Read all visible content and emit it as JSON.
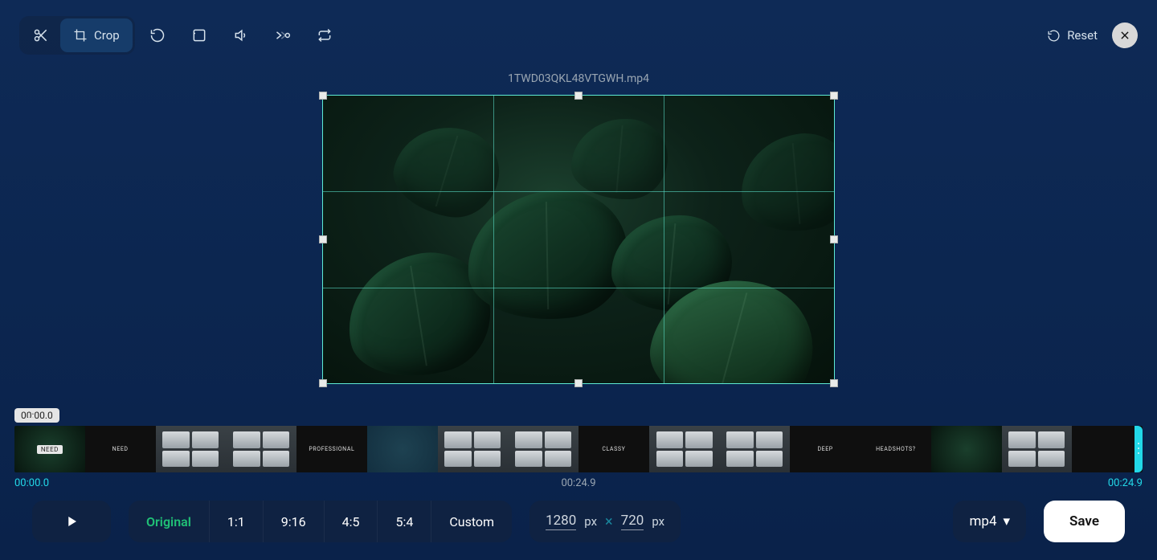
{
  "toolbar": {
    "crop_label": "Crop",
    "reset_label": "Reset"
  },
  "filename": "1TWD03QKL48VTGWH.mp4",
  "playhead_time": "00:00.0",
  "time": {
    "start": "00:00.0",
    "current": "00:24.9",
    "end": "00:24.9"
  },
  "thumb_captions": [
    "NEED",
    "NEED",
    "",
    "",
    "PROFESSIONAL",
    "",
    "",
    "",
    "CLASSY",
    "",
    "",
    "DEEP",
    "HEADSHOTS?",
    "",
    "",
    ""
  ],
  "ratios": [
    "Original",
    "1:1",
    "9:16",
    "4:5",
    "5:4",
    "Custom"
  ],
  "active_ratio": "Original",
  "dimensions": {
    "w": "1280",
    "h": "720",
    "unit": "px"
  },
  "format": "mp4",
  "save_label": "Save"
}
